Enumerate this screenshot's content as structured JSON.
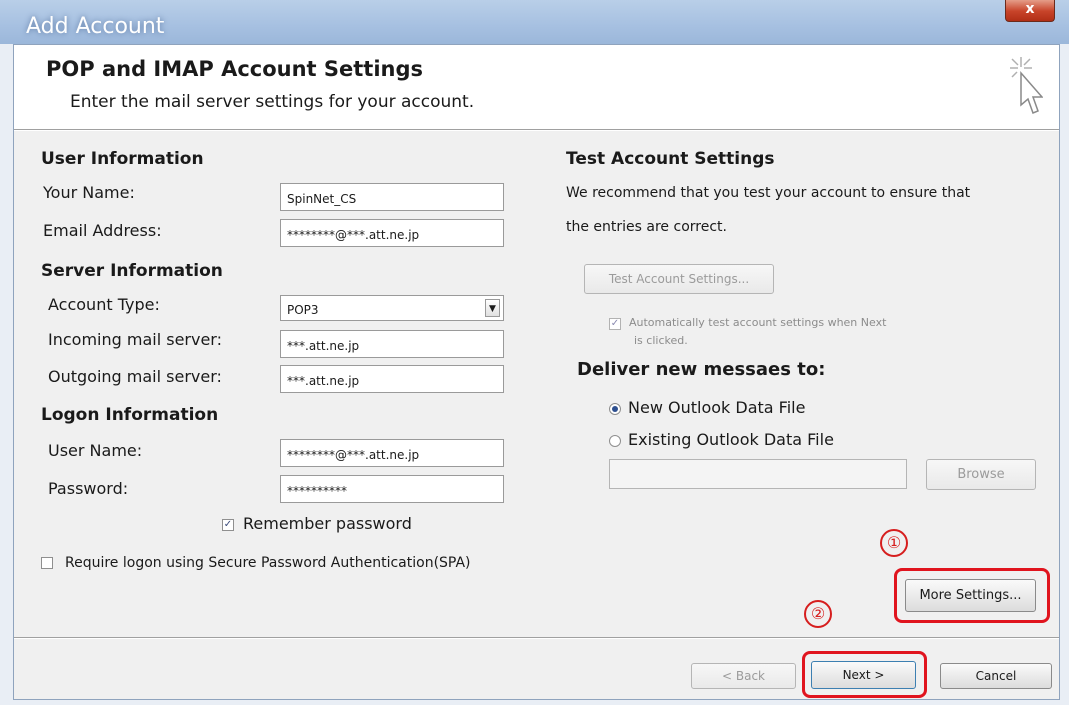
{
  "window": {
    "title": "Add Account",
    "close_glyph": "x"
  },
  "header": {
    "title": "POP and IMAP Account Settings",
    "subtitle": "Enter the mail server settings for your account.",
    "icon": "pointer-click-icon"
  },
  "user_information": {
    "heading": "User Information",
    "your_name_label": "Your Name:",
    "your_name_value": "SpinNet_CS",
    "email_label": "Email Address:",
    "email_value": "********@***.att.ne.jp"
  },
  "server_information": {
    "heading": "Server Information",
    "account_type_label": "Account Type:",
    "account_type_value": "POP3",
    "incoming_label": "Incoming mail server:",
    "incoming_value": "***.att.ne.jp",
    "outgoing_label": "Outgoing mail server:",
    "outgoing_value": "***.att.ne.jp"
  },
  "logon_information": {
    "heading": "Logon Information",
    "user_name_label": "User Name:",
    "user_name_value": "********@***.att.ne.jp",
    "password_label": "Password:",
    "password_value": "**********",
    "remember_label": "Remember password",
    "remember_checked": true,
    "spa_label": "Require logon using Secure Password Authentication(SPA)",
    "spa_checked": false
  },
  "test_settings": {
    "heading": "Test Account Settings",
    "description_line1": "We recommend that you test your account to ensure that",
    "description_line2": "the entries are correct.",
    "test_button": "Test Account Settings...",
    "auto_test_line1": "Automatically test account settings when Next",
    "auto_test_line2": "is clicked.",
    "auto_test_checked": true
  },
  "deliver": {
    "heading": "Deliver new messaes to:",
    "option_new": "New Outlook Data File",
    "option_existing": "Existing Outlook Data File",
    "selected": "New Outlook Data File",
    "existing_path": "",
    "browse_button": "Browse"
  },
  "more_settings_button": "More Settings...",
  "annotations": {
    "marker1": "①",
    "marker2": "②",
    "color": "#e0141e"
  },
  "footer": {
    "back": "< Back",
    "next": "Next  >",
    "cancel": "Cancel"
  }
}
